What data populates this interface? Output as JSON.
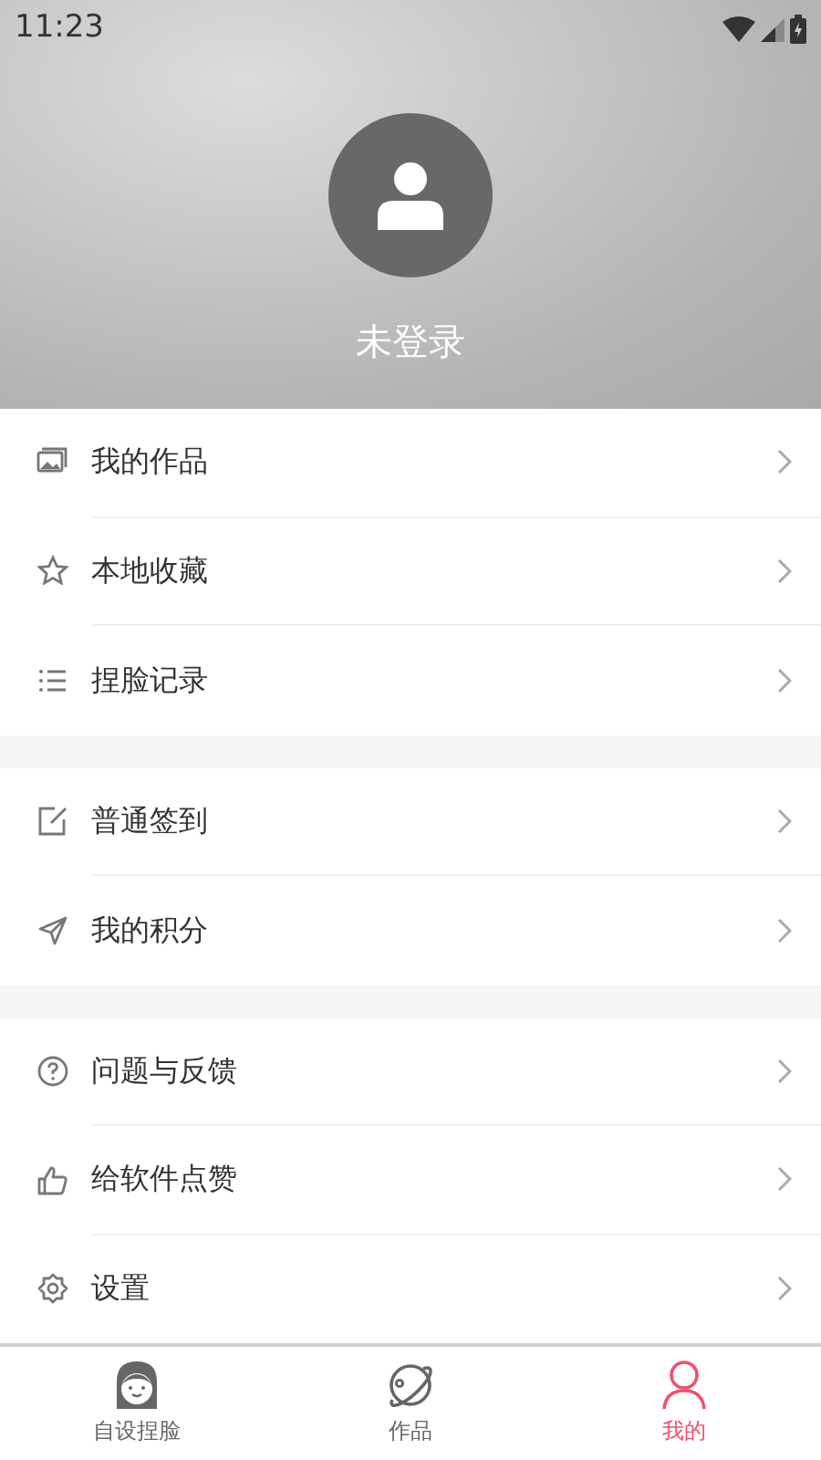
{
  "status_bar": {
    "time": "11:23"
  },
  "profile": {
    "name": "未登录"
  },
  "menu_groups": [
    {
      "items": [
        {
          "label": "我的作品"
        },
        {
          "label": "本地收藏"
        },
        {
          "label": "捏脸记录"
        }
      ]
    },
    {
      "items": [
        {
          "label": "普通签到"
        },
        {
          "label": "我的积分"
        }
      ]
    },
    {
      "items": [
        {
          "label": "问题与反馈"
        },
        {
          "label": "给软件点赞"
        },
        {
          "label": "设置"
        }
      ]
    }
  ],
  "tabs": [
    {
      "label": "自设捏脸",
      "selected": false
    },
    {
      "label": "作品",
      "selected": false
    },
    {
      "label": "我的",
      "selected": true
    }
  ]
}
